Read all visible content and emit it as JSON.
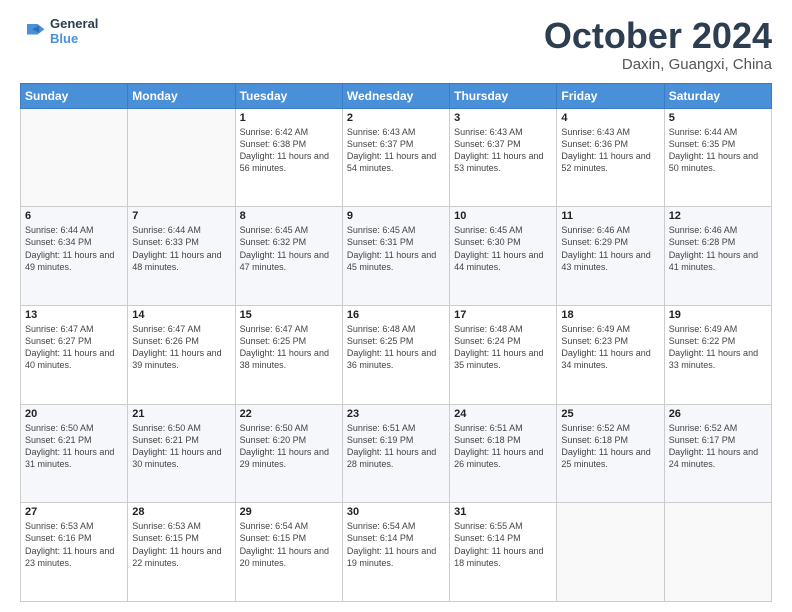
{
  "header": {
    "logo_line1": "General",
    "logo_line2": "Blue",
    "month": "October 2024",
    "location": "Daxin, Guangxi, China"
  },
  "weekdays": [
    "Sunday",
    "Monday",
    "Tuesday",
    "Wednesday",
    "Thursday",
    "Friday",
    "Saturday"
  ],
  "weeks": [
    [
      {
        "day": "",
        "info": ""
      },
      {
        "day": "",
        "info": ""
      },
      {
        "day": "1",
        "info": "Sunrise: 6:42 AM\nSunset: 6:38 PM\nDaylight: 11 hours and 56 minutes."
      },
      {
        "day": "2",
        "info": "Sunrise: 6:43 AM\nSunset: 6:37 PM\nDaylight: 11 hours and 54 minutes."
      },
      {
        "day": "3",
        "info": "Sunrise: 6:43 AM\nSunset: 6:37 PM\nDaylight: 11 hours and 53 minutes."
      },
      {
        "day": "4",
        "info": "Sunrise: 6:43 AM\nSunset: 6:36 PM\nDaylight: 11 hours and 52 minutes."
      },
      {
        "day": "5",
        "info": "Sunrise: 6:44 AM\nSunset: 6:35 PM\nDaylight: 11 hours and 50 minutes."
      }
    ],
    [
      {
        "day": "6",
        "info": "Sunrise: 6:44 AM\nSunset: 6:34 PM\nDaylight: 11 hours and 49 minutes."
      },
      {
        "day": "7",
        "info": "Sunrise: 6:44 AM\nSunset: 6:33 PM\nDaylight: 11 hours and 48 minutes."
      },
      {
        "day": "8",
        "info": "Sunrise: 6:45 AM\nSunset: 6:32 PM\nDaylight: 11 hours and 47 minutes."
      },
      {
        "day": "9",
        "info": "Sunrise: 6:45 AM\nSunset: 6:31 PM\nDaylight: 11 hours and 45 minutes."
      },
      {
        "day": "10",
        "info": "Sunrise: 6:45 AM\nSunset: 6:30 PM\nDaylight: 11 hours and 44 minutes."
      },
      {
        "day": "11",
        "info": "Sunrise: 6:46 AM\nSunset: 6:29 PM\nDaylight: 11 hours and 43 minutes."
      },
      {
        "day": "12",
        "info": "Sunrise: 6:46 AM\nSunset: 6:28 PM\nDaylight: 11 hours and 41 minutes."
      }
    ],
    [
      {
        "day": "13",
        "info": "Sunrise: 6:47 AM\nSunset: 6:27 PM\nDaylight: 11 hours and 40 minutes."
      },
      {
        "day": "14",
        "info": "Sunrise: 6:47 AM\nSunset: 6:26 PM\nDaylight: 11 hours and 39 minutes."
      },
      {
        "day": "15",
        "info": "Sunrise: 6:47 AM\nSunset: 6:25 PM\nDaylight: 11 hours and 38 minutes."
      },
      {
        "day": "16",
        "info": "Sunrise: 6:48 AM\nSunset: 6:25 PM\nDaylight: 11 hours and 36 minutes."
      },
      {
        "day": "17",
        "info": "Sunrise: 6:48 AM\nSunset: 6:24 PM\nDaylight: 11 hours and 35 minutes."
      },
      {
        "day": "18",
        "info": "Sunrise: 6:49 AM\nSunset: 6:23 PM\nDaylight: 11 hours and 34 minutes."
      },
      {
        "day": "19",
        "info": "Sunrise: 6:49 AM\nSunset: 6:22 PM\nDaylight: 11 hours and 33 minutes."
      }
    ],
    [
      {
        "day": "20",
        "info": "Sunrise: 6:50 AM\nSunset: 6:21 PM\nDaylight: 11 hours and 31 minutes."
      },
      {
        "day": "21",
        "info": "Sunrise: 6:50 AM\nSunset: 6:21 PM\nDaylight: 11 hours and 30 minutes."
      },
      {
        "day": "22",
        "info": "Sunrise: 6:50 AM\nSunset: 6:20 PM\nDaylight: 11 hours and 29 minutes."
      },
      {
        "day": "23",
        "info": "Sunrise: 6:51 AM\nSunset: 6:19 PM\nDaylight: 11 hours and 28 minutes."
      },
      {
        "day": "24",
        "info": "Sunrise: 6:51 AM\nSunset: 6:18 PM\nDaylight: 11 hours and 26 minutes."
      },
      {
        "day": "25",
        "info": "Sunrise: 6:52 AM\nSunset: 6:18 PM\nDaylight: 11 hours and 25 minutes."
      },
      {
        "day": "26",
        "info": "Sunrise: 6:52 AM\nSunset: 6:17 PM\nDaylight: 11 hours and 24 minutes."
      }
    ],
    [
      {
        "day": "27",
        "info": "Sunrise: 6:53 AM\nSunset: 6:16 PM\nDaylight: 11 hours and 23 minutes."
      },
      {
        "day": "28",
        "info": "Sunrise: 6:53 AM\nSunset: 6:15 PM\nDaylight: 11 hours and 22 minutes."
      },
      {
        "day": "29",
        "info": "Sunrise: 6:54 AM\nSunset: 6:15 PM\nDaylight: 11 hours and 20 minutes."
      },
      {
        "day": "30",
        "info": "Sunrise: 6:54 AM\nSunset: 6:14 PM\nDaylight: 11 hours and 19 minutes."
      },
      {
        "day": "31",
        "info": "Sunrise: 6:55 AM\nSunset: 6:14 PM\nDaylight: 11 hours and 18 minutes."
      },
      {
        "day": "",
        "info": ""
      },
      {
        "day": "",
        "info": ""
      }
    ]
  ]
}
